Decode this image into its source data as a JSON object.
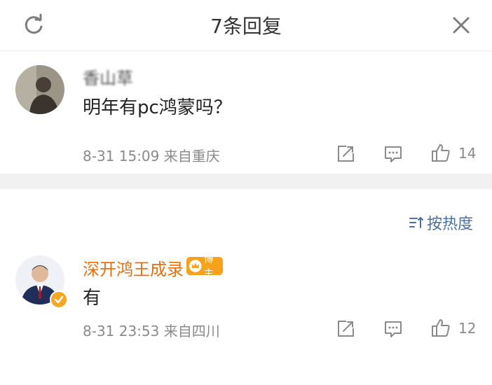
{
  "header": {
    "title": "7条回复",
    "refresh_icon": "refresh-icon",
    "close_icon": "close-icon"
  },
  "comments": [
    {
      "username": "香山草",
      "content": "明年有pc鸿蒙吗？",
      "meta": "8-31 15:09  来自重庆",
      "like_count": "14"
    },
    {
      "username": "深开鸿王成录",
      "badge": "博主",
      "content": "有",
      "meta": "8-31 23:53  来自四川",
      "like_count": "12"
    }
  ],
  "sort": {
    "label": "按热度",
    "icon": "sort-icon"
  },
  "colors": {
    "author_name": "#e8700c",
    "badge": "#f7a21b",
    "sort_link": "#4a6fa5",
    "meta_text": "#8a8a8a"
  }
}
